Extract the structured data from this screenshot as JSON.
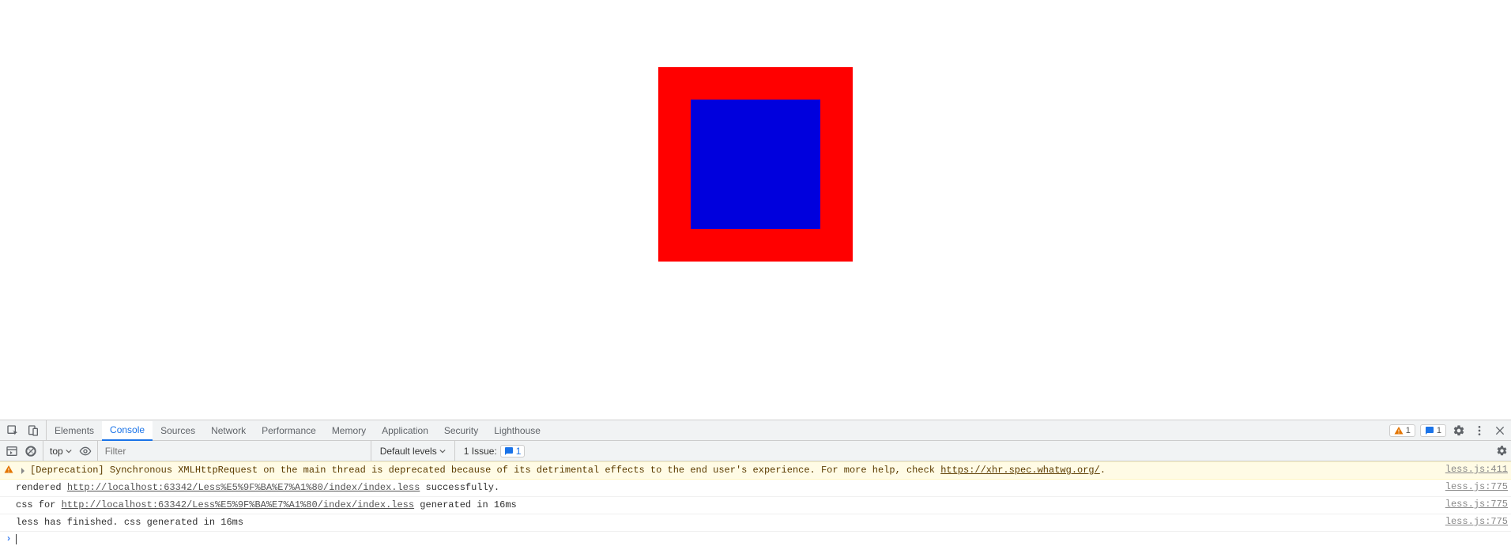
{
  "page": {
    "outer_color": "#ff0000",
    "inner_color": "#0000dd"
  },
  "devtools": {
    "tabs": [
      "Elements",
      "Console",
      "Sources",
      "Network",
      "Performance",
      "Memory",
      "Application",
      "Security",
      "Lighthouse"
    ],
    "active_tab": "Console",
    "badges": {
      "warnings": "1",
      "issues": "1"
    },
    "toolbar": {
      "context": "top",
      "filter_placeholder": "Filter",
      "levels": "Default levels",
      "issue_label": "1 Issue:",
      "issue_count": "1"
    },
    "messages": [
      {
        "level": "warning",
        "text_pre": "[Deprecation] Synchronous XMLHttpRequest on the main thread is deprecated because of its detrimental effects to the end user's experience. For more help, check ",
        "link": "https://xhr.spec.whatwg.org/",
        "text_post": ".",
        "source": "less.js:411"
      },
      {
        "level": "log",
        "text_pre": "rendered ",
        "link": "http://localhost:63342/Less%E5%9F%BA%E7%A1%80/index/index.less",
        "text_post": " successfully.",
        "source": "less.js:775"
      },
      {
        "level": "log",
        "text_pre": "css for ",
        "link": "http://localhost:63342/Less%E5%9F%BA%E7%A1%80/index/index.less",
        "text_post": " generated in 16ms",
        "source": "less.js:775"
      },
      {
        "level": "log",
        "text_pre": "less has finished. css generated in 16ms",
        "link": "",
        "text_post": "",
        "source": "less.js:775"
      }
    ]
  }
}
